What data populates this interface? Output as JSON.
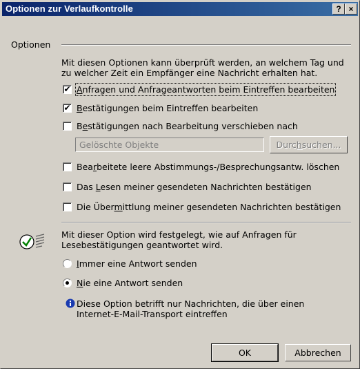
{
  "window": {
    "title": "Optionen zur Verlaufkontrolle",
    "help_button": "?",
    "close_button": "×"
  },
  "group_options": {
    "label": "Optionen",
    "description_line1": "Mit diesen Optionen kann überprüft werden, an welchem Tag und",
    "description_line2": "zu welcher Zeit ein Empfänger eine Nachricht erhalten hat.",
    "checkboxes": [
      {
        "pre": "",
        "accel": "A",
        "post": "nfragen und Anfrageantworten beim Eintreffen bearbeiten",
        "checked": true
      },
      {
        "pre": "",
        "accel": "B",
        "post": "estätigungen beim Eintreffen bearbeiten",
        "checked": true
      },
      {
        "pre": "B",
        "accel": "e",
        "post": "stätigungen nach Bearbeitung verschieben nach",
        "checked": false
      }
    ],
    "folder_field": {
      "value": "Gelöschte Objekte"
    },
    "browse_button": {
      "pre": "Durc",
      "accel": "h",
      "post": "suchen..."
    },
    "checkboxes2": [
      {
        "pre": "Bea",
        "accel": "r",
        "post": "beitete leere Abstimmungs-/Besprechungsantw. löschen",
        "checked": false
      },
      {
        "pre": "Das ",
        "accel": "L",
        "post": "esen meiner gesendeten Nachrichten bestätigen",
        "checked": false
      },
      {
        "pre": "Die Über",
        "accel": "m",
        "post": "ittlung meiner gesendeten Nachrichten bestätigen",
        "checked": false
      }
    ]
  },
  "read_receipt": {
    "description_line1": "Mit dieser Option wird festgelegt, wie auf Anfragen für",
    "description_line2": "Lesebestätigungen geantwortet wird.",
    "radios": [
      {
        "pre": "",
        "accel": "I",
        "post": "mmer eine Antwort senden",
        "selected": false
      },
      {
        "pre": "",
        "accel": "N",
        "post": "ie eine Antwort senden",
        "selected": true
      }
    ],
    "info_line1": "Diese Option betrifft nur Nachrichten, die über einen",
    "info_line2": "Internet-E-Mail-Transport eintreffen"
  },
  "buttons": {
    "ok": "OK",
    "cancel": "Abbrechen"
  }
}
